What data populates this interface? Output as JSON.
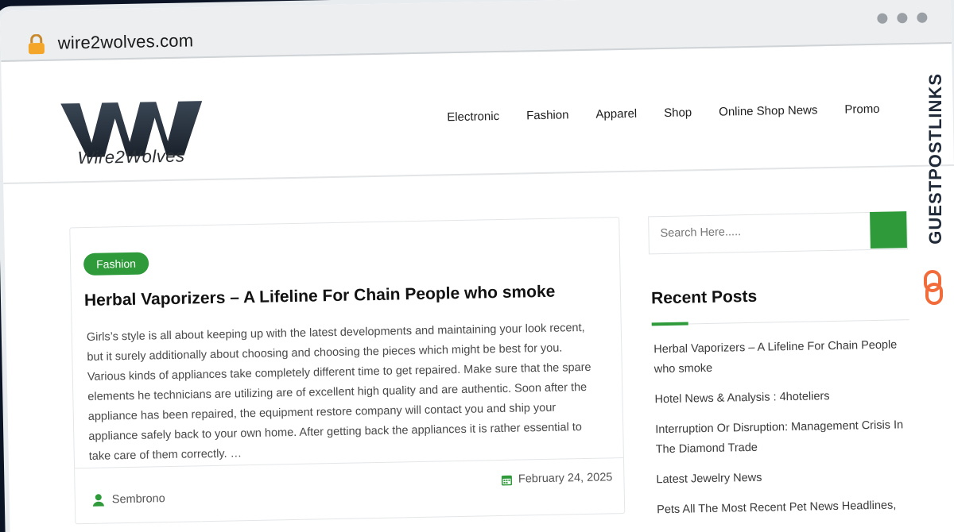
{
  "browser": {
    "url": "wire2wolves.com"
  },
  "site": {
    "logo_text": "Wire2Wolves",
    "nav": [
      "Electronic",
      "Fashion",
      "Apparel",
      "Shop",
      "Online Shop News",
      "Promo"
    ]
  },
  "post": {
    "category": "Fashion",
    "title": "Herbal Vaporizers – A Lifeline For Chain People who smoke",
    "excerpt": "Girls’s style is all about keeping up with the latest developments and maintaining your look recent, but it surely additionally about choosing and choosing the pieces which might be best for you. Various kinds of appliances take completely different time to get repaired. Make sure that the spare elements he technicians are utilizing are of excellent high quality and are authentic. Soon after the appliance has been repaired, the equipment restore company will contact you and ship your appliance safely back to your own home. After getting back the appliances it is rather essential to take care of them correctly. …",
    "author": "Sembrono",
    "date": "February 24, 2025"
  },
  "sidebar": {
    "search_placeholder": "Search Here.....",
    "recent_title": "Recent Posts",
    "recent_posts": [
      "Herbal Vaporizers – A Lifeline For Chain People who smoke",
      "Hotel News & Analysis : 4hoteliers",
      "Interruption Or Disruption: Management Crisis In The Diamond Trade",
      "Latest Jewelry News",
      "Pets All The Most Recent Pet News Headlines,"
    ]
  },
  "banner": {
    "text": "GUESTPOSTLINKS"
  },
  "colors": {
    "accent": "#2e9a3a",
    "background": "#0a1424"
  }
}
